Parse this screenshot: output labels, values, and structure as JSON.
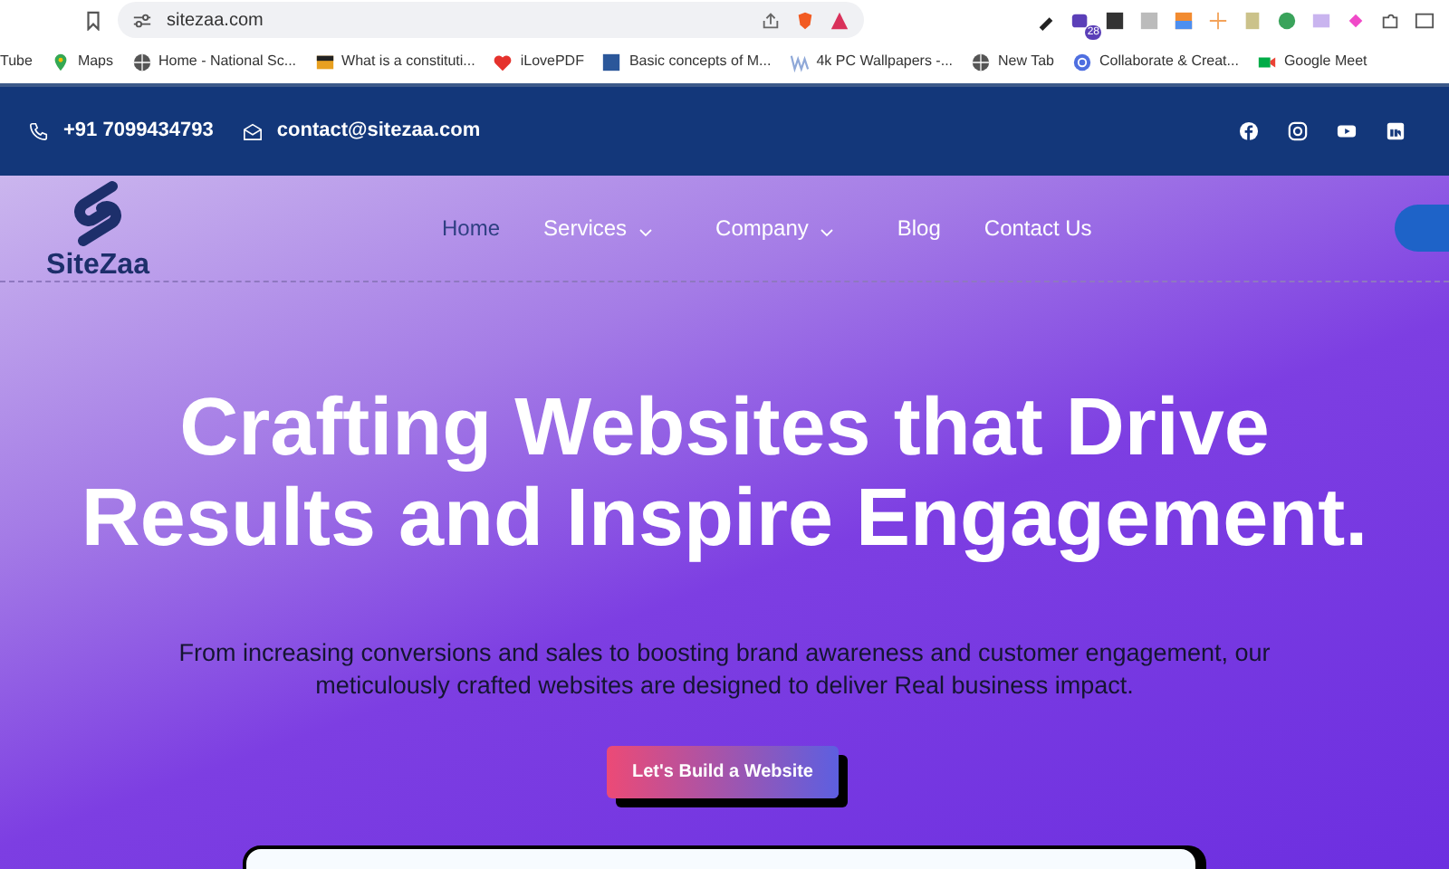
{
  "browser": {
    "address": "sitezaa.com",
    "extension_badge": "28",
    "bookmarks": [
      {
        "label": "Tube"
      },
      {
        "label": "Maps"
      },
      {
        "label": "Home - National Sc..."
      },
      {
        "label": "What is a constituti..."
      },
      {
        "label": "iLovePDF"
      },
      {
        "label": "Basic concepts of M..."
      },
      {
        "label": "4k PC Wallpapers -..."
      },
      {
        "label": "New Tab"
      },
      {
        "label": "Collaborate & Creat..."
      },
      {
        "label": "Google Meet"
      }
    ]
  },
  "topbar": {
    "phone": "+91 7099434793",
    "email": "contact@sitezaa.com"
  },
  "nav": {
    "logo": "SiteZaa",
    "items": [
      {
        "label": "Home",
        "selected": true,
        "dropdown": false
      },
      {
        "label": "Services",
        "selected": false,
        "dropdown": true
      },
      {
        "label": "Company",
        "selected": false,
        "dropdown": true
      },
      {
        "label": "Blog",
        "selected": false,
        "dropdown": false
      },
      {
        "label": "Contact Us",
        "selected": false,
        "dropdown": false
      }
    ]
  },
  "hero": {
    "title": "Crafting Websites that Drive Results and Inspire Engagement.",
    "subtitle": "From increasing conversions and sales to boosting brand awareness and customer engagement, our meticulously crafted websites are designed to deliver Real business impact.",
    "button": "Let's Build a Website"
  }
}
